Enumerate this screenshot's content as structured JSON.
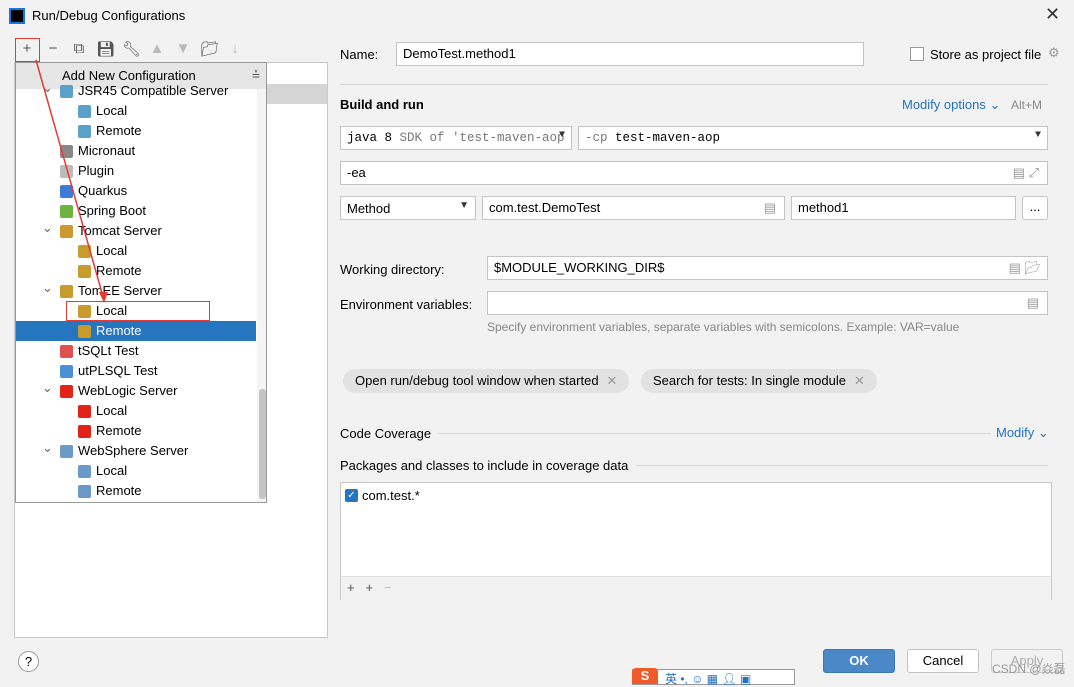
{
  "window": {
    "title": "Run/Debug Configurations"
  },
  "toolbar": [
    "add-icon",
    "remove-icon",
    "copy-icon",
    "save-icon",
    "wrench-icon",
    "move-up-icon",
    "move-down-icon",
    "new-folder-icon",
    "sort-icon"
  ],
  "popup": {
    "header": "Add New Configuration",
    "items": [
      {
        "label": "JSR45 Compatible Server",
        "level": 1,
        "expanded": true,
        "icon": "jsr45"
      },
      {
        "label": "Local",
        "level": 2,
        "icon": "jsr45"
      },
      {
        "label": "Remote",
        "level": 2,
        "icon": "jsr45"
      },
      {
        "label": "Micronaut",
        "level": 1,
        "icon": "micronaut"
      },
      {
        "label": "Plugin",
        "level": 1,
        "icon": "plugin"
      },
      {
        "label": "Quarkus",
        "level": 1,
        "icon": "quarkus"
      },
      {
        "label": "Spring Boot",
        "level": 1,
        "icon": "spring"
      },
      {
        "label": "Tomcat Server",
        "level": 1,
        "expanded": true,
        "icon": "tomcat"
      },
      {
        "label": "Local",
        "level": 2,
        "icon": "tomcat"
      },
      {
        "label": "Remote",
        "level": 2,
        "icon": "tomcat"
      },
      {
        "label": "TomEE Server",
        "level": 1,
        "expanded": true,
        "icon": "tomcat"
      },
      {
        "label": "Local",
        "level": 2,
        "icon": "tomcat"
      },
      {
        "label": "Remote",
        "level": 2,
        "icon": "tomcat",
        "selected": true
      },
      {
        "label": "tSQLt Test",
        "level": 1,
        "icon": "tsqlt"
      },
      {
        "label": "utPLSQL Test",
        "level": 1,
        "icon": "utplsql"
      },
      {
        "label": "WebLogic Server",
        "level": 1,
        "expanded": true,
        "icon": "weblogic"
      },
      {
        "label": "Local",
        "level": 2,
        "icon": "weblogic"
      },
      {
        "label": "Remote",
        "level": 2,
        "icon": "weblogic"
      },
      {
        "label": "WebSphere Server",
        "level": 1,
        "expanded": true,
        "icon": "websphere"
      },
      {
        "label": "Local",
        "level": 2,
        "icon": "websphere"
      },
      {
        "label": "Remote",
        "level": 2,
        "icon": "websphere"
      }
    ]
  },
  "form": {
    "name_label": "Name:",
    "name_value": "DemoTest.method1",
    "store_label": "Store as project file",
    "build_run": "Build and run",
    "modify_options": "Modify options",
    "modify_shortcut": "Alt+M",
    "jdk_java": "java 8",
    "jdk_sdk": "SDK of 'test-maven-aop",
    "cp_flag": "-cp",
    "cp_value": "test-maven-aop",
    "vm_options": "-ea",
    "test_kind": "Method",
    "class_value": "com.test.DemoTest",
    "method_value": "method1",
    "more": "...",
    "workdir_label": "Working directory:",
    "workdir_value": "$MODULE_WORKING_DIR$",
    "env_label": "Environment variables:",
    "env_value": "",
    "env_hint": "Specify environment variables, separate variables with semicolons. Example: VAR=value",
    "chip1": "Open run/debug tool window when started",
    "chip2": "Search for tests: In single module",
    "coverage": "Code Coverage",
    "coverage_modify": "Modify",
    "packages_label": "Packages and classes to include in coverage data",
    "package_item": "com.test.*",
    "package_checked": true
  },
  "buttons": {
    "ok": "OK",
    "cancel": "Cancel",
    "apply": "Apply"
  },
  "watermark": "CSDN @焱磊",
  "ime": {
    "lang": "英"
  },
  "colors": {
    "selection": "#2675bf",
    "ok": "#4a88c7",
    "link": "#2470c4",
    "annotation": "#e53935"
  }
}
